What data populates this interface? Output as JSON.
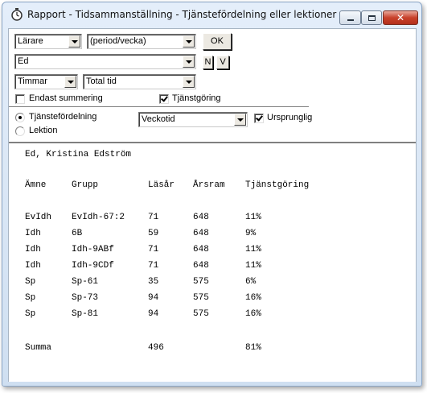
{
  "window": {
    "title": "Rapport - Tidsammanställning - Tjänstefördelning eller lektioner",
    "close_label": "✕"
  },
  "controls": {
    "category_select": "Lärare",
    "period_select": "(period/vecka)",
    "ok_label": "OK",
    "name_select": "Ed",
    "n_label": "N",
    "v_label": "V",
    "unit_select": "Timmar",
    "time_select": "Total tid",
    "only_summary_label": "Endast summering",
    "only_summary_checked": false,
    "tjanstgoring_label": "Tjänstgöring",
    "tjanstgoring_checked": true,
    "radio_tjanst_label": "Tjänstefördelning",
    "radio_tjanst_selected": true,
    "radio_lektion_label": "Lektion",
    "radio_lektion_selected": false,
    "veckotid_select": "Veckotid",
    "ursprunglig_label": "Ursprunglig",
    "ursprunglig_checked": true
  },
  "report": {
    "heading": "Ed, Kristina Edström",
    "columns": [
      "Ämne",
      "Grupp",
      "Läsår",
      "Årsram",
      "Tjänstgöring"
    ],
    "rows": [
      [
        "EvIdh",
        "EvIdh-67:2",
        "71",
        "648",
        "11%"
      ],
      [
        "Idh",
        "6B",
        "59",
        "648",
        "9%"
      ],
      [
        "Idh",
        "Idh-9ABf",
        "71",
        "648",
        "11%"
      ],
      [
        "Idh",
        "Idh-9CDf",
        "71",
        "648",
        "11%"
      ],
      [
        "Sp",
        "Sp-61",
        "35",
        "575",
        "6%"
      ],
      [
        "Sp",
        "Sp-73",
        "94",
        "575",
        "16%"
      ],
      [
        "Sp",
        "Sp-81",
        "94",
        "575",
        "16%"
      ]
    ],
    "summary": [
      "Summa",
      "",
      "496",
      "",
      "81%"
    ]
  }
}
